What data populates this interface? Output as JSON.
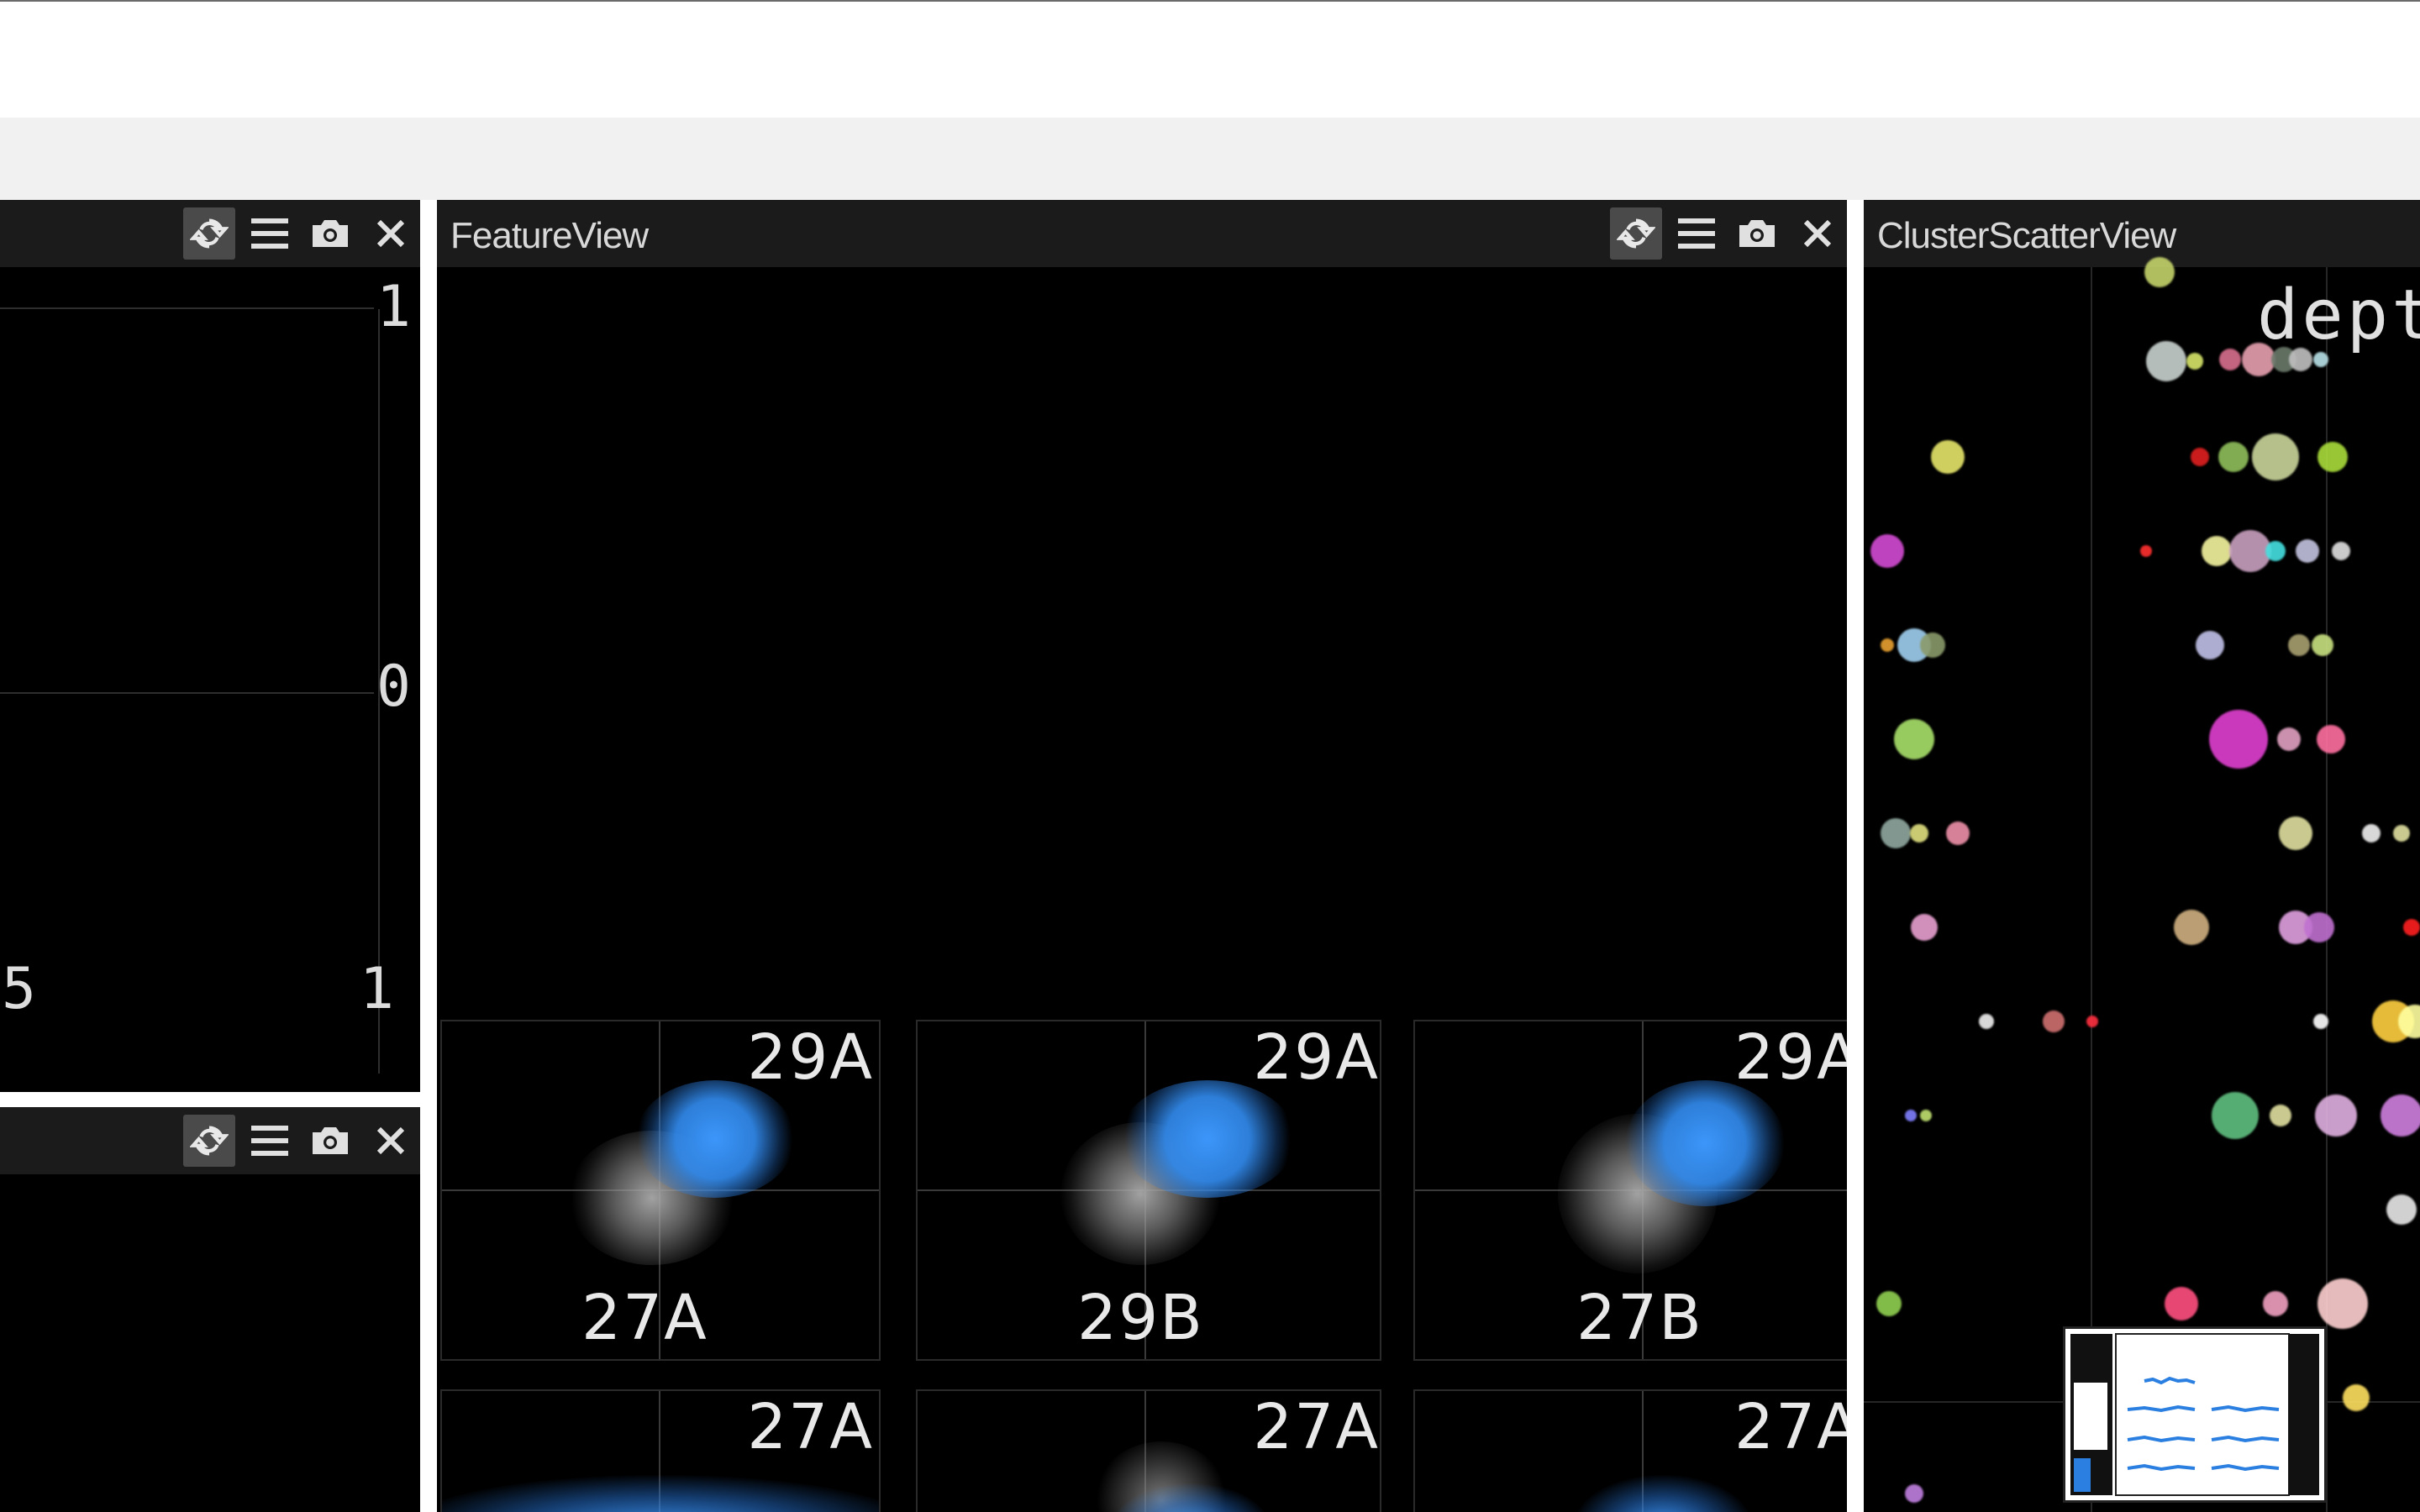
{
  "left_top_panel": {
    "axis": {
      "top": "1",
      "middle": "0",
      "bottom_right": "1",
      "bottom_left": "5"
    }
  },
  "feature_view": {
    "title": "FeatureView",
    "subplots": [
      {
        "top_label": "29A",
        "bottom_label": "27A"
      },
      {
        "top_label": "29A",
        "bottom_label": "29B"
      },
      {
        "top_label": "29A",
        "bottom_label": "27B"
      },
      {
        "top_label": "27A",
        "bottom_label": ""
      },
      {
        "top_label": "27A",
        "bottom_label": ""
      },
      {
        "top_label": "27A",
        "bottom_label": ""
      }
    ]
  },
  "cluster_scatter_view": {
    "title": "ClusterScatterView",
    "axis_label": "dept"
  },
  "icons": [
    "refresh-icon",
    "menu-icon",
    "camera-icon",
    "close-icon"
  ],
  "colors": {
    "panel_bg": "#000000",
    "titlebar_bg": "#1b1b1b",
    "cluster_blue": "#3a8ef0",
    "noise_gray": "#9a9a9a"
  }
}
